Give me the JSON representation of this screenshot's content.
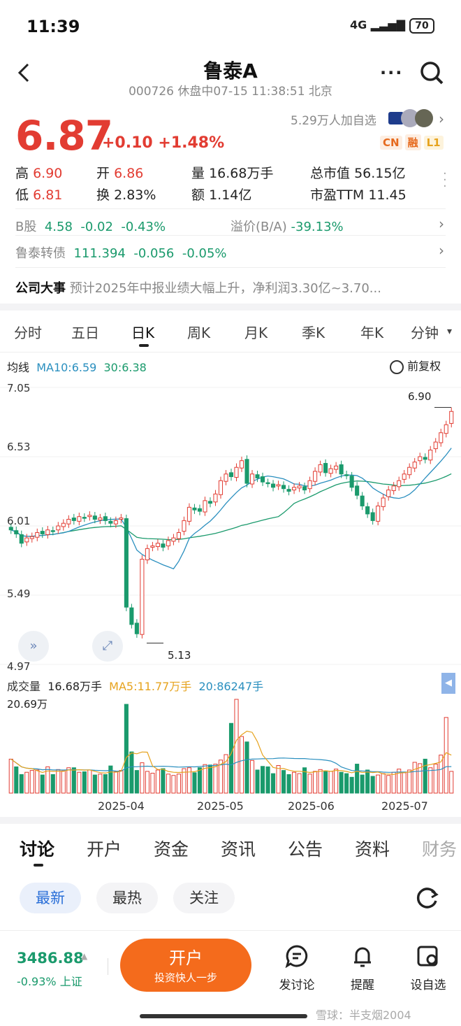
{
  "status": {
    "time": "11:39",
    "network": "4G",
    "battery": "70"
  },
  "header": {
    "title": "鲁泰A",
    "subtitle": "000726 休盘中07-15 11:38:51 北京"
  },
  "quote": {
    "price": "6.87",
    "change": "+0.10",
    "change_pct": "+1.48%",
    "followers": "5.29万人加自选",
    "badges": [
      "CN",
      "融",
      "L1"
    ],
    "high_label": "高",
    "high": "6.90",
    "open_label": "开",
    "open": "6.86",
    "vol_label": "量",
    "volume": "16.68万手",
    "mcap_label": "总市值",
    "mcap": "56.15亿",
    "low_label": "低",
    "low": "6.81",
    "turn_label": "换",
    "turnover": "2.83%",
    "amt_label": "额",
    "amount": "1.14亿",
    "pe_label": "市盈TTM",
    "pe": "11.45"
  },
  "bshare": {
    "label": "B股",
    "price": "4.58",
    "change": "-0.02",
    "pct": "-0.43%",
    "premium_label": "溢价(B/A)",
    "premium": "-39.13%"
  },
  "bond": {
    "label": "鲁泰转债",
    "price": "111.394",
    "change": "-0.056",
    "pct": "-0.05%"
  },
  "event": {
    "label": "公司大事",
    "text": "预计2025年中报业绩大幅上升，净利润3.30亿~3.70..."
  },
  "chart_tabs": [
    "分时",
    "五日",
    "日K",
    "周K",
    "月K",
    "季K",
    "年K",
    "分钟"
  ],
  "ma_line": {
    "label": "均线",
    "ma10": "MA10:6.59",
    "ma30": "30:6.38",
    "adjust": "前复权"
  },
  "vol_line": {
    "label": "成交量",
    "vol": "16.68万手",
    "ma5": "MA5:11.77万手",
    "ma20": "20:86247手",
    "max": "20.69万"
  },
  "chart_data": {
    "type": "candlestick",
    "y_ticks": [
      "7.05",
      "6.53",
      "6.01",
      "5.49",
      "4.97"
    ],
    "ylim": [
      4.97,
      7.05
    ],
    "x_ticks": [
      "2025-04",
      "2025-05",
      "2025-06",
      "2025-07"
    ],
    "max_label": "6.90",
    "min_label": "5.13",
    "closes": [
      5.98,
      5.95,
      5.88,
      5.92,
      5.93,
      5.96,
      5.95,
      5.98,
      5.97,
      6.01,
      6.03,
      6.06,
      6.05,
      6.08,
      6.07,
      6.09,
      6.06,
      6.07,
      6.05,
      6.03,
      6.05,
      6.07,
      5.4,
      5.27,
      5.2,
      5.76,
      5.84,
      5.86,
      5.88,
      5.85,
      5.9,
      5.92,
      5.96,
      6.05,
      6.15,
      6.13,
      6.12,
      6.2,
      6.18,
      6.25,
      6.35,
      6.4,
      6.38,
      6.45,
      6.5,
      6.33,
      6.4,
      6.37,
      6.34,
      6.33,
      6.3,
      6.32,
      6.29,
      6.27,
      6.3,
      6.31,
      6.28,
      6.35,
      6.42,
      6.47,
      6.41,
      6.44,
      6.46,
      6.4,
      6.39,
      6.3,
      6.24,
      6.16,
      6.1,
      6.05,
      6.16,
      6.22,
      6.28,
      6.31,
      6.35,
      6.4,
      6.45,
      6.49,
      6.53,
      6.51,
      6.58,
      6.64,
      6.71,
      6.77,
      6.87
    ],
    "volumes_wan": [
      7.5,
      5.8,
      4.1,
      4.6,
      5.0,
      5.1,
      4.0,
      5.8,
      4.1,
      5.2,
      4.9,
      5.6,
      5.6,
      4.6,
      4.7,
      5.1,
      4.0,
      4.2,
      4.1,
      6.0,
      4.7,
      5.0,
      19.6,
      9.1,
      5.0,
      6.7,
      4.8,
      4.4,
      5.1,
      5.4,
      4.2,
      3.9,
      4.2,
      5.4,
      5.6,
      4.5,
      5.6,
      6.3,
      6.2,
      6.4,
      7.3,
      8.5,
      15.4,
      20.7,
      12.5,
      11.3,
      7.2,
      5.1,
      5.9,
      5.8,
      4.3,
      6.1,
      5.0,
      4.1,
      4.6,
      4.3,
      5.6,
      4.2,
      4.8,
      5.2,
      4.9,
      4.8,
      5.3,
      4.6,
      4.3,
      3.5,
      6.4,
      4.0,
      5.1,
      3.7,
      4.0,
      4.3,
      3.9,
      4.6,
      5.3,
      4.5,
      5.1,
      6.8,
      6.5,
      7.5,
      5.6,
      6.4,
      8.4,
      16.7,
      4.8
    ],
    "ma10": "6.59",
    "ma30": "6.38"
  },
  "bottom_tabs": [
    "讨论",
    "开户",
    "资金",
    "资讯",
    "公告",
    "资料",
    "财务"
  ],
  "pills": [
    "最新",
    "最热",
    "关注"
  ],
  "index": {
    "value": "3486.88",
    "change": "-0.93% 上证"
  },
  "cta": {
    "main": "开户",
    "sub": "投资快人一步"
  },
  "actions": [
    "发讨论",
    "提醒",
    "设自选"
  ],
  "watermark": "雪球：半支烟2004",
  "colors": {
    "up": "#e23c32",
    "down": "#1a9a6c",
    "accent": "#f46b1c",
    "ma10": "#2a8fbf",
    "ma30": "#1a9a6c",
    "ma5": "#e6a31e"
  }
}
